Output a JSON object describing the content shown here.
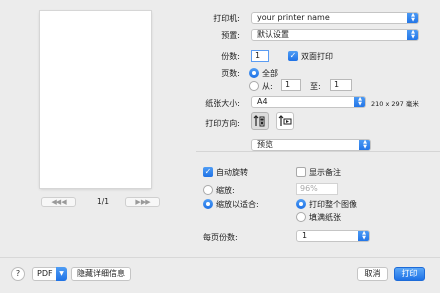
{
  "preview": {
    "prev_label": "◀◀  ◀",
    "next_label": "▶  ▶▶",
    "page_counter": "1/1"
  },
  "printer": {
    "label": "打印机:",
    "value": "your printer name"
  },
  "presets": {
    "label": "预置:",
    "value": "默认设置"
  },
  "copies": {
    "label": "份数:",
    "value": "1",
    "duplex_label": "双面打印",
    "duplex_checked": true
  },
  "pages": {
    "label": "页数:",
    "all_label": "全部",
    "from_label": "从:",
    "from_value": "1",
    "to_label": "至:",
    "to_value": "1",
    "selected": "all"
  },
  "paper_size": {
    "label": "纸张大小:",
    "value": "A4",
    "dimensions": "210 x 297 毫米"
  },
  "orientation": {
    "label": "打印方向:",
    "selected": "portrait"
  },
  "section": {
    "value": "预览"
  },
  "options": {
    "auto_rotate_label": "自动旋转",
    "auto_rotate_checked": true,
    "show_notes_label": "显示备注",
    "show_notes_checked": false,
    "scale_label": "缩放:",
    "scale_value": "96%",
    "scale_to_fit_label": "缩放以适合:",
    "print_entire_label": "打印整个图像",
    "fill_paper_label": "填满纸张",
    "scale_mode": "scale_to_fit",
    "fit_mode": "print_entire"
  },
  "pages_per_sheet": {
    "label": "每页份数:",
    "value": "1"
  },
  "footer": {
    "help_label": "?",
    "pdf_label": "PDF",
    "hide_details_label": "隐藏详细信息",
    "cancel_label": "取消",
    "print_label": "打印"
  },
  "colors": {
    "accent": "#1f72e6",
    "background": "#ececec"
  },
  "icons": {
    "stepper": "chevron-up-down-icon",
    "portrait": "portrait-orientation-icon",
    "landscape": "landscape-orientation-icon",
    "pdf_menu": "chevron-down-icon"
  }
}
